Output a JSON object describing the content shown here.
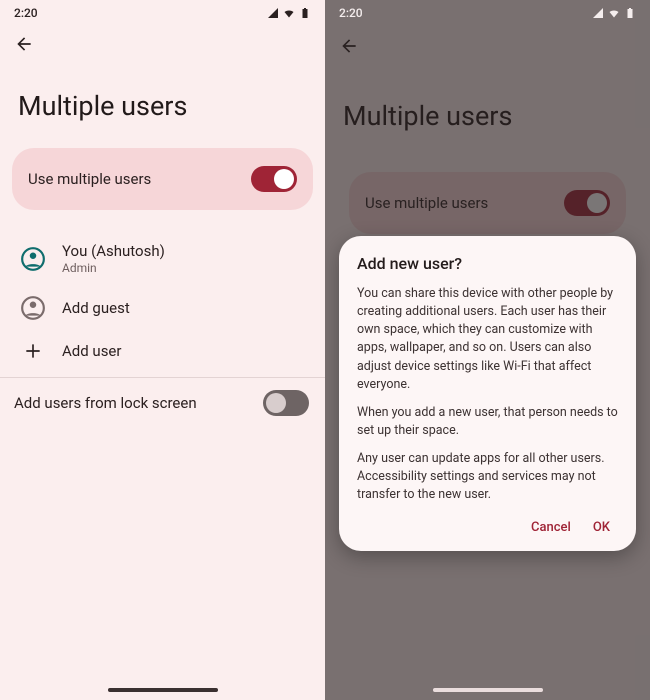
{
  "statusbar": {
    "time": "2:20",
    "extra": "⧉"
  },
  "header": {
    "title": "Multiple users"
  },
  "card": {
    "label": "Use multiple users",
    "toggle_on": true
  },
  "users": [
    {
      "primary": "You (Ashutosh)",
      "secondary": "Admin",
      "icon": "person-circle"
    },
    {
      "primary": "Add guest",
      "secondary": "",
      "icon": "person-outline"
    },
    {
      "primary": "Add user",
      "secondary": "",
      "icon": "plus"
    }
  ],
  "lockscreen": {
    "label": "Add users from lock screen",
    "toggle_on": false
  },
  "dialog": {
    "title": "Add new user?",
    "p1": "You can share this device with other people by creating additional users. Each user has their own space, which they can customize with apps, wallpaper, and so on. Users can also adjust device settings like Wi-Fi that affect everyone.",
    "p2": "When you add a new user, that person needs to set up their space.",
    "p3": "Any user can update apps for all other users. Accessibility settings and services may not transfer to the new user.",
    "cancel": "Cancel",
    "ok": "OK"
  }
}
